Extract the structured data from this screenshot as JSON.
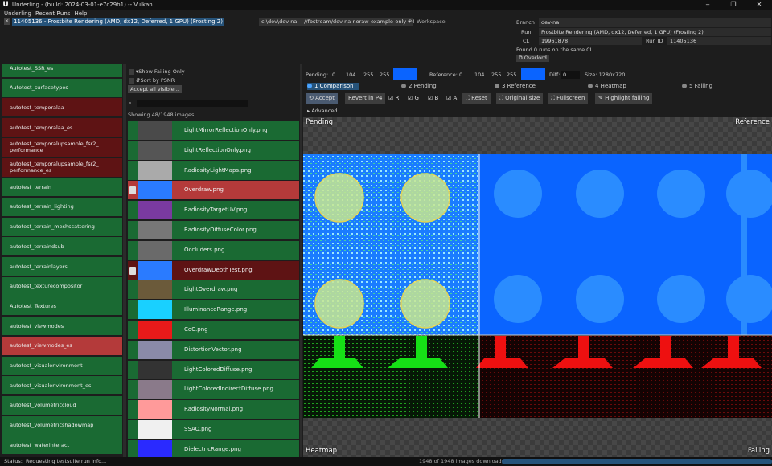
{
  "titlebar": {
    "title": "Underling - (build: 2024-03-01-e7c29b1) -- Vulkan",
    "minimize": "‒",
    "maximize": "❐",
    "close": "✕"
  },
  "menu": [
    "Underling",
    "Recent Runs",
    "Help"
  ],
  "header": {
    "run_selector": "11405136 - Frostbite Rendering (AMD, dx12, Deferred, 1 GPU) (Frosting 2)",
    "path_selector": "c:\\dev\\dev-na -- //fbstream/dev-na-noraw-example-only",
    "p4_workspace": "P4 Workspace",
    "branch_label": "Branch",
    "branch": "dev-na",
    "run_label": "Run",
    "run": "Frostbite Rendering (AMD, dx12, Deferred, 1 GPU) (Frosting 2)",
    "cl_label": "CL",
    "cl": "19961878",
    "run_id_label": "Run ID",
    "run_id": "11405136",
    "found_runs": "Found 0 runs on the same CL",
    "overlord": "Overlord"
  },
  "suites": [
    {
      "name": "Autotest_SSR_es",
      "state": "pass"
    },
    {
      "name": "Autotest_surfacetypes",
      "state": "pass"
    },
    {
      "name": "autotest_temporalaa",
      "state": "fail"
    },
    {
      "name": "autotest_temporalaa_es",
      "state": "fail"
    },
    {
      "name": "autotest_temporalupsample_fsr2_\nperformance",
      "state": "fail"
    },
    {
      "name": "autotest_temporalupsample_fsr2_\nperformance_es",
      "state": "fail"
    },
    {
      "name": "autotest_terrain",
      "state": "pass"
    },
    {
      "name": "autotest_terrain_lighting",
      "state": "pass"
    },
    {
      "name": "autotest_terrain_meshscattering",
      "state": "pass"
    },
    {
      "name": "autotest_terraindsub",
      "state": "pass"
    },
    {
      "name": "autotest_terrainlayers",
      "state": "pass"
    },
    {
      "name": "autotest_texturecompositor",
      "state": "pass"
    },
    {
      "name": "Autotest_Textures",
      "state": "pass"
    },
    {
      "name": "autotest_viewmodes",
      "state": "pass"
    },
    {
      "name": "autotest_viewmodes_es",
      "state": "sel"
    },
    {
      "name": "autotest_visualenvironment",
      "state": "pass"
    },
    {
      "name": "autotest_visualenvironment_es",
      "state": "pass"
    },
    {
      "name": "autotest_volumetriccloud",
      "state": "pass"
    },
    {
      "name": "autotest_volumetricshadowmap",
      "state": "pass"
    },
    {
      "name": "autotest_waterinteract",
      "state": "pass"
    }
  ],
  "filters": {
    "show_failing": "Show Failing Only",
    "sort_psnr": "Sort by PSNR",
    "accept_all": "Accept all visible...",
    "showing": "Showing 48/1948 images"
  },
  "images": [
    {
      "name": "LightMirrorReflectionOnly.png",
      "state": "pass",
      "thumb": "#4a4a4a"
    },
    {
      "name": "LightReflectionOnly.png",
      "state": "pass",
      "thumb": "#555"
    },
    {
      "name": "RadiosityLightMaps.png",
      "state": "pass",
      "thumb": "#aaa"
    },
    {
      "name": "Overdraw.png",
      "state": "sel",
      "thumb": "#2a7bff"
    },
    {
      "name": "RadiosityTargetUV.png",
      "state": "pass",
      "thumb": "#7a3aa0"
    },
    {
      "name": "RadiosityDiffuseColor.png",
      "state": "pass",
      "thumb": "#777"
    },
    {
      "name": "Occluders.png",
      "state": "pass",
      "thumb": "#6a6a6a"
    },
    {
      "name": "OverdrawDepthTest.png",
      "state": "fail",
      "thumb": "#2a7bff"
    },
    {
      "name": "LightOverdraw.png",
      "state": "pass",
      "thumb": "#6b5a3a"
    },
    {
      "name": "IlluminanceRange.png",
      "state": "pass",
      "thumb": "#19d0ff"
    },
    {
      "name": "CoC.png",
      "state": "pass",
      "thumb": "#e81a1a"
    },
    {
      "name": "DistortionVector.png",
      "state": "pass",
      "thumb": "#8a8aa8"
    },
    {
      "name": "LightColoredDiffuse.png",
      "state": "pass",
      "thumb": "#333"
    },
    {
      "name": "LightColoredIndirectDiffuse.png",
      "state": "pass",
      "thumb": "#8a7a8a"
    },
    {
      "name": "RadiosityNormal.png",
      "state": "pass",
      "thumb": "#ff9a9a"
    },
    {
      "name": "SSAO.png",
      "state": "pass",
      "thumb": "#f0f0f0"
    },
    {
      "name": "DielectricRange.png",
      "state": "pass",
      "thumb": "#2a2aff"
    }
  ],
  "toolbar": {
    "pending_label": "Pending:",
    "pending_vals": [
      "0",
      "104",
      "255",
      "255"
    ],
    "reference_label": "Reference:",
    "reference_vals": [
      "0",
      "104",
      "255",
      "255"
    ],
    "diff_label": "Diff:",
    "diff_val": "0",
    "size": "Size: 1280x720",
    "tabs": [
      "1 Comparison",
      "2 Pending",
      "3 Reference",
      "4 Heatmap",
      "5 Failing"
    ],
    "accept": "Accept",
    "revert": "Revert in P4",
    "channels": [
      "R",
      "G",
      "B",
      "A"
    ],
    "reset": "Reset",
    "original_size": "Original size",
    "fullscreen": "Fullscreen",
    "highlight": "Highlight failing",
    "advanced": "Advanced"
  },
  "viewer": {
    "top_left": "Pending",
    "top_right": "Reference",
    "bottom_left": "Heatmap",
    "bottom_right": "Failing"
  },
  "status": {
    "label": "Status:",
    "text": "Requesting testsuite run info...",
    "downloads": "1948 of 1948 images downloaded"
  },
  "colors": {
    "pass": "#1a6a33",
    "fail": "#5e1314",
    "selected": "#b43a3a",
    "accent": "#26537a",
    "swatch": "#0a64ff"
  }
}
